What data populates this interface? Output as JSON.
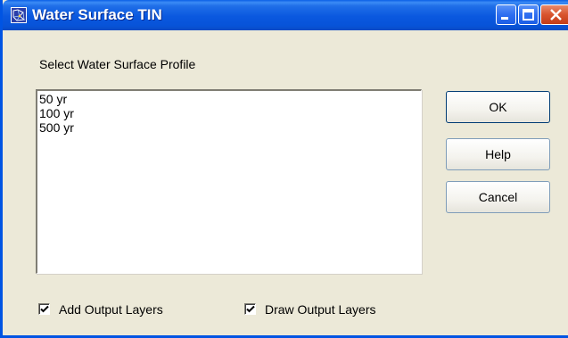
{
  "window": {
    "title": "Water Surface TIN",
    "icon": "tin-app-icon"
  },
  "dialog": {
    "prompt": "Select Water Surface Profile",
    "profiles": [
      "50 yr",
      "100 yr",
      "500 yr"
    ]
  },
  "buttons": {
    "ok": "OK",
    "help": "Help",
    "cancel": "Cancel"
  },
  "options": {
    "add_output_layers": {
      "label": "Add Output Layers",
      "checked": true
    },
    "draw_output_layers": {
      "label": "Draw Output Layers",
      "checked": true
    }
  },
  "colors": {
    "titlebar": "#0a58df",
    "dialog_bg": "#ece9d8",
    "close_button": "#d8532e"
  }
}
